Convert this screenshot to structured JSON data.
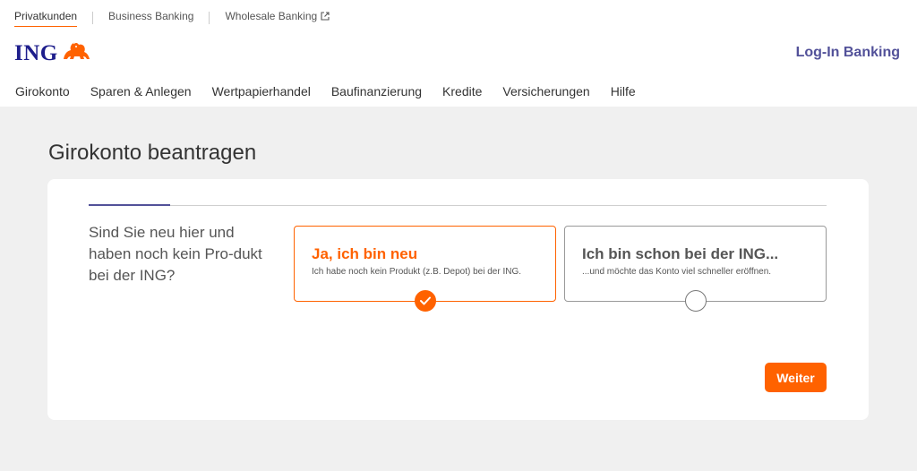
{
  "topnav": {
    "items": [
      {
        "label": "Privatkunden"
      },
      {
        "label": "Business Banking"
      },
      {
        "label": "Wholesale Banking"
      }
    ],
    "external_icon": "external-link-icon"
  },
  "logo": {
    "text": "ING",
    "icon": "lion-icon"
  },
  "login": {
    "label": "Log-In Banking"
  },
  "mainnav": {
    "items": [
      {
        "label": "Girokonto"
      },
      {
        "label": "Sparen & Anlegen"
      },
      {
        "label": "Wertpapierhandel"
      },
      {
        "label": "Baufinanzierung"
      },
      {
        "label": "Kredite"
      },
      {
        "label": "Versicherungen"
      },
      {
        "label": "Hilfe"
      }
    ]
  },
  "page": {
    "title": "Girokonto beantragen"
  },
  "form": {
    "progress": 0.11,
    "question": "Sind Sie neu hier und haben noch kein Pro-dukt bei der ING?",
    "options": [
      {
        "title": "Ja, ich bin neu",
        "subtitle": "Ich habe noch kein Produkt (z.B. Depot) bei der ING.",
        "selected": true
      },
      {
        "title": "Ich bin schon bei der ING...",
        "subtitle": "...und möchte das Konto viel schneller eröffnen.",
        "selected": false
      }
    ],
    "next_label": "Weiter"
  },
  "colors": {
    "brand_orange": "#ff6200",
    "brand_blue": "#1e1e8c",
    "accent_purple": "#525199"
  }
}
